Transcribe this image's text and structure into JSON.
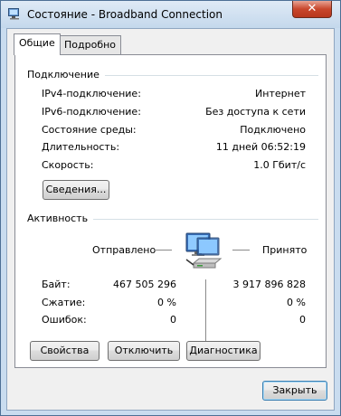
{
  "window": {
    "title": "Состояние - Broadband Connection",
    "close_glyph": "✕"
  },
  "tabs": [
    {
      "label": "Общие",
      "active": true
    },
    {
      "label": "Подробно",
      "active": false
    }
  ],
  "connection": {
    "group_title": "Подключение",
    "rows": [
      {
        "label": "IPv4-подключение:",
        "value": "Интернет"
      },
      {
        "label": "IPv6-подключение:",
        "value": "Без доступа к сети"
      },
      {
        "label": "Состояние среды:",
        "value": "Подключено"
      },
      {
        "label": "Длительность:",
        "value": "11 дней 06:52:19"
      },
      {
        "label": "Скорость:",
        "value": "1.0 Гбит/с"
      }
    ],
    "details_button": "Сведения..."
  },
  "activity": {
    "group_title": "Активность",
    "sent_label": "Отправлено",
    "received_label": "Принято",
    "icon": "network-computer-icon",
    "rows": [
      {
        "label": "Байт:",
        "sent": "467 505 296",
        "received": "3 917 896 828"
      },
      {
        "label": "Сжатие:",
        "sent": "0 %",
        "received": "0 %"
      },
      {
        "label": "Ошибок:",
        "sent": "0",
        "received": "0"
      }
    ]
  },
  "actions": {
    "properties": "Свойства",
    "disable": "Отключить",
    "diagnose": "Диагностика"
  },
  "footer": {
    "close": "Закрыть"
  }
}
